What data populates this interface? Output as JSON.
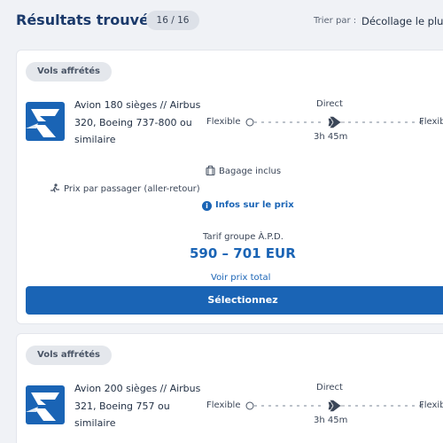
{
  "header": {
    "title": "Résultats trouvés",
    "count": "16 / 16",
    "sort_label": "Trier par :",
    "sort_value": "Décollage le plus t"
  },
  "results": [
    {
      "chip": "Vols affrétés",
      "aircraft": [
        "Avion 180 sièges // Airbus",
        "320, Boeing 737-800 ou",
        "similaire"
      ],
      "flex_left": "Flexible",
      "flex_right": "Flexib",
      "direct": "Direct",
      "duration": "3h 45m",
      "baggage": "Bagage inclus",
      "pax_price": "Prix par passager (aller-retour)",
      "price_info": "Infos sur le prix",
      "tariff": "Tarif groupe À.P.D.",
      "price": "590 – 701 EUR",
      "total_link": "Voir prix total",
      "select_button": "Sélectionnez"
    },
    {
      "chip": "Vols affrétés",
      "aircraft": [
        "Avion 200 sièges // Airbus",
        "321, Boeing 757 ou",
        "similaire"
      ],
      "flex_left": "Flexible",
      "flex_right": "Flexib",
      "direct": "Direct",
      "duration": "3h 45m"
    }
  ],
  "colors": {
    "accent": "#1a64b5",
    "title": "#1b3a6b",
    "background": "#f0f2f6",
    "chip_bg": "#e4e7ec"
  },
  "icons": [
    "airline-logo",
    "plane-icon",
    "luggage-icon",
    "passenger-icon",
    "info-icon"
  ]
}
